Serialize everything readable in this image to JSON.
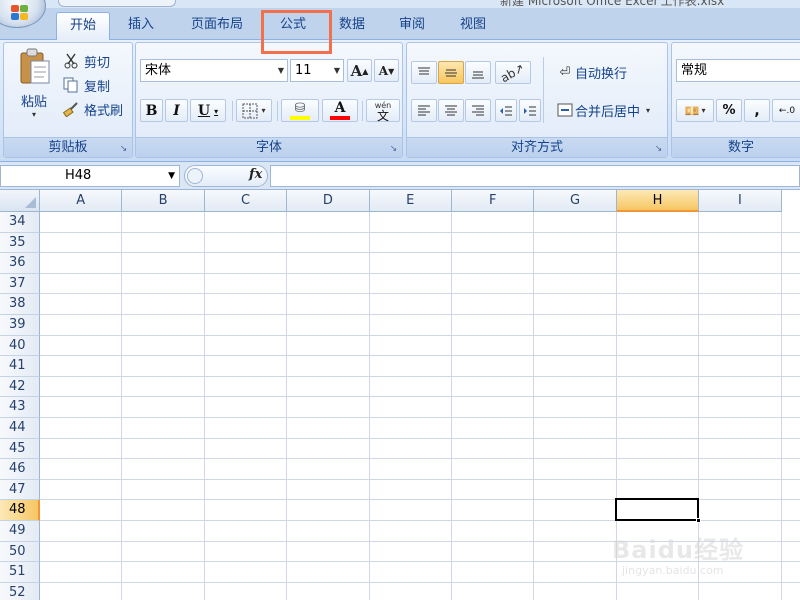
{
  "window": {
    "title": "新建 Microsoft Office Excel 工作表.xlsx"
  },
  "tabs": [
    {
      "label": "开始",
      "active": true
    },
    {
      "label": "插入"
    },
    {
      "label": "页面布局"
    },
    {
      "label": "公式",
      "highlighted": true
    },
    {
      "label": "数据"
    },
    {
      "label": "审阅"
    },
    {
      "label": "视图"
    }
  ],
  "clipboard": {
    "group_label": "剪贴板",
    "paste_label": "粘贴",
    "cut_label": "剪切",
    "copy_label": "复制",
    "format_painter_label": "格式刷"
  },
  "font": {
    "group_label": "字体",
    "font_name": "宋体",
    "font_size": "11",
    "grow_label": "A",
    "shrink_label": "A",
    "bold_label": "B",
    "italic_label": "I",
    "underline_label": "U",
    "font_color_label": "A",
    "phonetic_label": "wén",
    "phonetic_char": "文",
    "highlight_color": "#ffff00",
    "font_color": "#ff0000"
  },
  "alignment": {
    "group_label": "对齐方式",
    "wrap_text_label": "自动换行",
    "merge_center_label": "合并后居中"
  },
  "number": {
    "group_label": "数字",
    "format_value": "常规",
    "percent_label": "%",
    "comma_label": ","
  },
  "formula_bar": {
    "name_box": "H48",
    "fx_label": "fx",
    "content": ""
  },
  "grid": {
    "columns": [
      "A",
      "B",
      "C",
      "D",
      "E",
      "F",
      "G",
      "H",
      "I"
    ],
    "rows": [
      "34",
      "35",
      "36",
      "37",
      "38",
      "39",
      "40",
      "41",
      "42",
      "43",
      "44",
      "45",
      "46",
      "47",
      "48",
      "49",
      "50",
      "51",
      "52"
    ],
    "selected_column": "H",
    "selected_row": "48",
    "active_cell": "H48"
  },
  "watermark": {
    "brand": "Baidu经验",
    "url": "jingyan.baidu.com"
  },
  "colors": {
    "ribbon_text": "#15428b",
    "tab_bar": "#bfd3ec",
    "highlight_box": "#f2714c",
    "selected_header": "#f6c663"
  }
}
